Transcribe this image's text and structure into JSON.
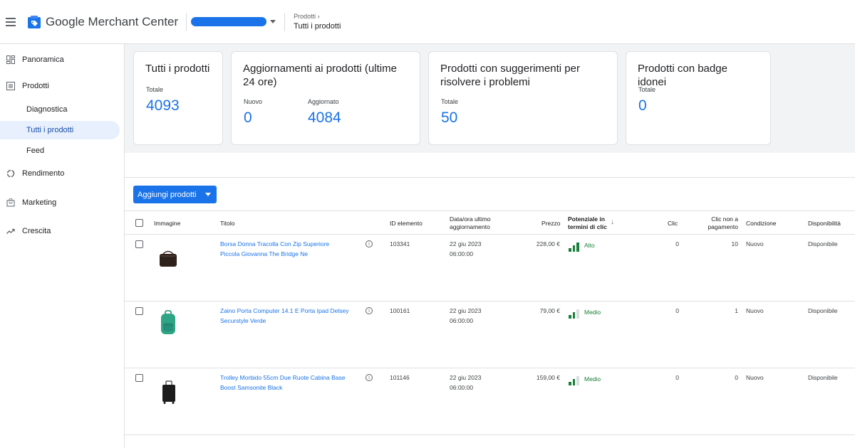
{
  "header": {
    "app_name": "Google Merchant Center",
    "breadcrumb_parent": "Prodotti ›",
    "breadcrumb_current": "Tutti i prodotti",
    "brand_color": "#1a73e8"
  },
  "sidebar": {
    "items": [
      {
        "label": "Panoramica",
        "icon": "dashboard-icon"
      },
      {
        "label": "Prodotti",
        "icon": "list-icon"
      },
      {
        "label": "Diagnostica"
      },
      {
        "label": "Tutti i prodotti",
        "active": true
      },
      {
        "label": "Feed"
      },
      {
        "label": "Rendimento",
        "icon": "donut-icon"
      },
      {
        "label": "Marketing",
        "icon": "shopping-bag-icon"
      },
      {
        "label": "Crescita",
        "icon": "trending-up-icon"
      }
    ]
  },
  "summary": {
    "all_products": {
      "title": "Tutti i prodotti",
      "label": "Totale",
      "value": "4093"
    },
    "updates": {
      "title": "Aggiornamenti ai prodotti (ultime 24 ore)",
      "new_label": "Nuovo",
      "new_value": "0",
      "updated_label": "Aggiornato",
      "updated_value": "4084"
    },
    "suggestions": {
      "title": "Prodotti con suggerimenti per risolvere i problemi",
      "label": "Totale",
      "value": "50"
    },
    "badges": {
      "title": "Prodotti con badge idonei",
      "label": "Totale",
      "value": "0"
    }
  },
  "toolbar": {
    "add_label": "Aggiungi prodotti"
  },
  "table": {
    "headers": {
      "image": "Immagine",
      "title": "Titolo",
      "id": "ID elemento",
      "updated_1": "Data/ora ultimo",
      "updated_2": "aggiornamento",
      "price": "Prezzo",
      "potential_1": "Potenziale in",
      "potential_2": "termini di clic",
      "clicks": "Clic",
      "unpaid_1": "Clic non a",
      "unpaid_2": "pagamento",
      "condition": "Condizione",
      "availability": "Disponibilità"
    },
    "rows": [
      {
        "title_1": "Borsa Donna Tracolla Con Zip Superiore",
        "title_2": "Piccola Giovanna The Bridge Ne",
        "id": "103341",
        "date": "22 giu 2023",
        "time": "06:00:00",
        "price": "228,00 €",
        "potential": "Alto",
        "potential_level": 3,
        "clicks": "0",
        "unpaid": "10",
        "condition": "Nuovo",
        "availability": "Disponibile",
        "thumb": "bag-icon"
      },
      {
        "title_1": "Zaino Porta Computer 14.1 E Porta Ipad Delsey",
        "title_2": "Securstyle Verde",
        "id": "100161",
        "date": "22 giu 2023",
        "time": "06:00:00",
        "price": "79,00 €",
        "potential": "Medio",
        "potential_level": 2,
        "clicks": "0",
        "unpaid": "1",
        "condition": "Nuovo",
        "availability": "Disponibile",
        "thumb": "backpack-icon"
      },
      {
        "title_1": "Trolley Morbido 55cm Due Ruote Cabina Base",
        "title_2": "Boost Samsonite Black",
        "id": "101146",
        "date": "22 giu 2023",
        "time": "06:00:00",
        "price": "159,00 €",
        "potential": "Medio",
        "potential_level": 2,
        "clicks": "0",
        "unpaid": "0",
        "condition": "Nuovo",
        "availability": "Disponibile",
        "thumb": "suitcase-icon"
      }
    ]
  }
}
